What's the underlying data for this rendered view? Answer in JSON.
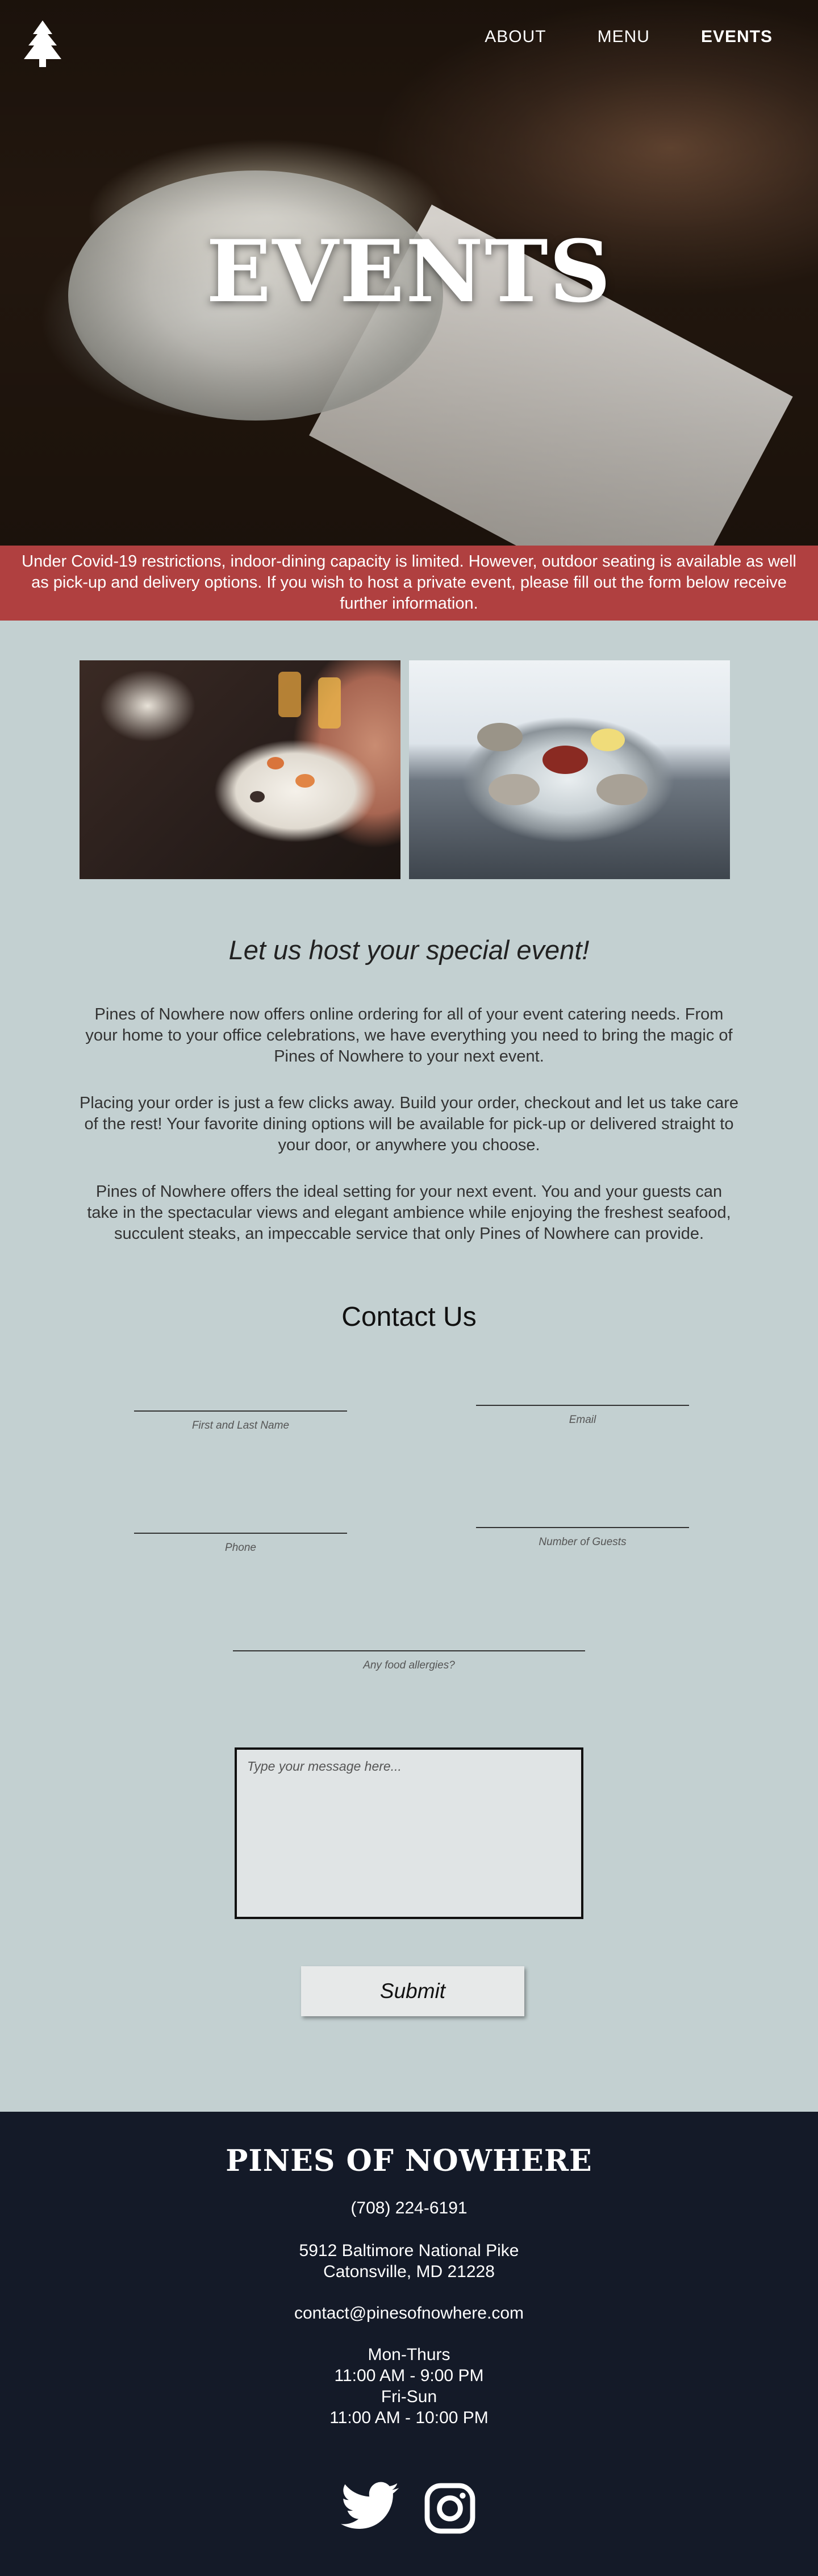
{
  "nav": {
    "logo_alt": "pine-tree-logo",
    "links": [
      {
        "label": "ABOUT",
        "active": false
      },
      {
        "label": "MENU",
        "active": false
      },
      {
        "label": "EVENTS",
        "active": true
      }
    ]
  },
  "hero": {
    "title": "EVENTS"
  },
  "notice": {
    "text": "Under Covid-19 restrictions, indoor-dining capacity is limited. However, outdoor seating is available as well as pick-up and delivery options. If you wish to host a private event, please fill out the form below receive further information."
  },
  "intro": {
    "heading": "Let us host your special event!",
    "paragraphs": [
      "Pines of Nowhere now offers online ordering for all of your event catering needs. From your home to your office celebrations, we have everything you need to bring the magic of Pines of Nowhere to your next event.",
      "Placing your order is just a few clicks away. Build your order, checkout and let us take care of the rest! Your favorite dining options will be available for pick-up or delivered straight to your door, or anywhere you choose.",
      "Pines of Nowhere offers the ideal setting for your next event. You and your guests can take in the spectacular views and elegant ambience while enjoying the freshest seafood, succulent steaks, an impeccable service that only Pines of Nowhere can provide."
    ]
  },
  "contact": {
    "title": "Contact Us",
    "fields": {
      "name_label": "First and Last Name",
      "email_label": "Email",
      "phone_label": "Phone",
      "guests_label": "Number of Guests",
      "allergies_label": "Any food allergies?"
    },
    "message_placeholder": "Type your message here...",
    "submit_label": "Submit"
  },
  "footer": {
    "brand": "PINES OF NOWHERE",
    "phone": "(708) 224-6191",
    "address_line1": "5912 Baltimore National Pike",
    "address_line2": "Catonsville, MD 21228",
    "email": "contact@pinesofnowhere.com",
    "hours": [
      "Mon-Thurs",
      "11:00 AM - 9:00 PM",
      "Fri-Sun",
      "11:00 AM - 10:00 PM"
    ],
    "social": [
      "twitter-icon",
      "instagram-icon"
    ]
  },
  "colors": {
    "notice_bg": "#b04040",
    "page_bg": "#c3d0d1",
    "footer_bg": "#141a28"
  }
}
